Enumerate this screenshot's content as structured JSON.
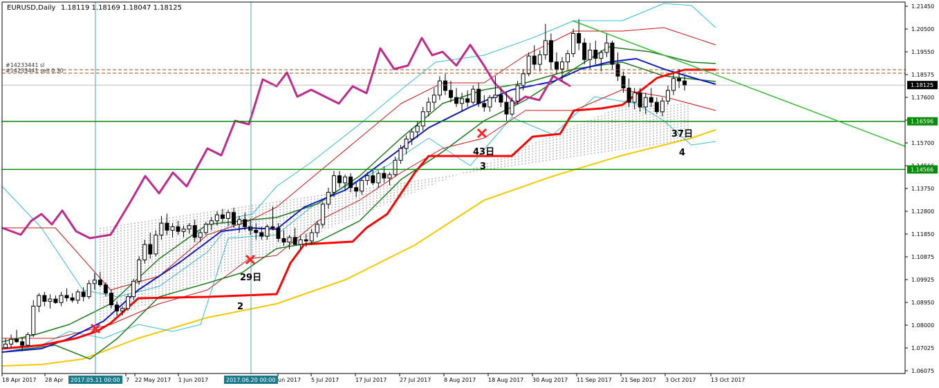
{
  "header": {
    "symbol": "EURUSD,Daily",
    "ohlc": "1.18119 1.18169 1.18047 1.18125"
  },
  "order_labels": [
    "#14233441 sl",
    "#14233441 sell 0.30"
  ],
  "colors": {
    "background": "#ffffff",
    "frame": "#000000",
    "bb_outer": "#33bbdd",
    "bb_inner": "#cc1111",
    "ma_green": "#1a7a1a",
    "ma_blue": "#0a14c8",
    "ma_gold": "#f5c800",
    "chikou": "#c0288c",
    "support_red": "#ff0000",
    "hline": "#0a8a0a",
    "trendline": "#33bb33",
    "current_badge": "#000000"
  },
  "price_axis": {
    "labels": [
      "1.21450",
      "1.20500",
      "1.19550",
      "1.18575",
      "1.17600",
      "1.16596",
      "1.15700",
      "1.14566",
      "1.13750",
      "1.12800",
      "1.11850",
      "1.10875",
      "1.09925",
      "1.08950",
      "1.08000",
      "1.07025",
      "1.06075"
    ],
    "current_price": "1.18125",
    "hline_labels": [
      "1.16596",
      "1.14566"
    ]
  },
  "time_axis": {
    "labels": [
      "18 Apr 2017",
      "28 Apr",
      "7",
      "22 May 2017",
      "1 Jun 2017",
      "un 2017",
      "5 Jul 2017",
      "17 Jul 2017",
      "27 Jul 2017",
      "8 Aug 2017",
      "18 Aug 2017",
      "30 Aug 2017",
      "11 Sep 2017",
      "21 Sep 2017",
      "3 Oct 2017",
      "13 Oct 2017"
    ],
    "crosshair_tags": [
      "2017.05.11 00:00",
      "2017.06.20 00:00"
    ]
  },
  "annotations": [
    {
      "text": "29日",
      "number": "2"
    },
    {
      "text": "43日",
      "number": "3"
    },
    {
      "text": "37日",
      "number": "4"
    }
  ],
  "chart_data": {
    "type": "candlestick",
    "symbol": "EURUSD",
    "timeframe": "Daily",
    "ylim": [
      1.06075,
      1.2145
    ],
    "last_close": 1.18125,
    "horizontal_levels": [
      1.16596,
      1.14566
    ],
    "candles_ohlc": [
      [
        1.0705,
        1.0745,
        1.07,
        1.072
      ],
      [
        1.072,
        1.076,
        1.0705,
        1.074
      ],
      [
        1.074,
        1.078,
        1.0725,
        1.073
      ],
      [
        1.073,
        1.0745,
        1.069,
        1.0715
      ],
      [
        1.0715,
        1.077,
        1.071,
        1.076
      ],
      [
        1.076,
        1.0905,
        1.075,
        1.088
      ],
      [
        1.088,
        1.0935,
        1.0855,
        1.0925
      ],
      [
        1.0925,
        1.094,
        1.088,
        1.09
      ],
      [
        1.09,
        1.093,
        1.087,
        1.091
      ],
      [
        1.091,
        1.0925,
        1.089,
        1.0895
      ],
      [
        1.0895,
        1.094,
        1.088,
        1.0925
      ],
      [
        1.0925,
        1.0955,
        1.09,
        1.0915
      ],
      [
        1.0915,
        1.0935,
        1.0895,
        1.0905
      ],
      [
        1.0905,
        1.095,
        1.089,
        1.094
      ],
      [
        1.094,
        1.096,
        1.09,
        1.092
      ],
      [
        1.092,
        1.099,
        1.091,
        1.0975
      ],
      [
        1.0975,
        1.102,
        1.095,
        1.099
      ],
      [
        1.099,
        1.1025,
        1.096,
        1.097
      ],
      [
        1.097,
        1.098,
        1.092,
        1.0935
      ],
      [
        1.0935,
        1.095,
        1.087,
        1.0885
      ],
      [
        1.0885,
        1.09,
        1.084,
        1.086
      ],
      [
        1.086,
        1.088,
        1.084,
        1.087
      ],
      [
        1.087,
        1.093,
        1.086,
        1.092
      ],
      [
        1.092,
        1.0995,
        1.0905,
        1.0985
      ],
      [
        1.0985,
        1.109,
        1.097,
        1.1075
      ],
      [
        1.1075,
        1.116,
        1.106,
        1.114
      ],
      [
        1.114,
        1.119,
        1.108,
        1.11
      ],
      [
        1.11,
        1.12,
        1.109,
        1.118
      ],
      [
        1.118,
        1.126,
        1.116,
        1.123
      ],
      [
        1.123,
        1.127,
        1.118,
        1.12
      ],
      [
        1.12,
        1.123,
        1.117,
        1.1215
      ],
      [
        1.1215,
        1.124,
        1.118,
        1.1195
      ],
      [
        1.1195,
        1.122,
        1.117,
        1.1205
      ],
      [
        1.1205,
        1.123,
        1.1185,
        1.122
      ],
      [
        1.122,
        1.1245,
        1.115,
        1.117
      ],
      [
        1.117,
        1.12,
        1.115,
        1.119
      ],
      [
        1.119,
        1.1235,
        1.118,
        1.1225
      ],
      [
        1.1225,
        1.1255,
        1.12,
        1.124
      ],
      [
        1.124,
        1.128,
        1.122,
        1.1265
      ],
      [
        1.1265,
        1.129,
        1.123,
        1.125
      ],
      [
        1.125,
        1.1285,
        1.122,
        1.1275
      ],
      [
        1.1275,
        1.1295,
        1.121,
        1.1225
      ],
      [
        1.1225,
        1.126,
        1.119,
        1.1245
      ],
      [
        1.1245,
        1.1275,
        1.12,
        1.1215
      ],
      [
        1.1215,
        1.125,
        1.118,
        1.12
      ],
      [
        1.12,
        1.123,
        1.116,
        1.119
      ],
      [
        1.119,
        1.1215,
        1.116,
        1.1175
      ],
      [
        1.1175,
        1.1225,
        1.116,
        1.1215
      ],
      [
        1.1215,
        1.13,
        1.12,
        1.121
      ],
      [
        1.121,
        1.123,
        1.115,
        1.1165
      ],
      [
        1.1165,
        1.12,
        1.1135,
        1.115
      ],
      [
        1.115,
        1.118,
        1.112,
        1.117
      ],
      [
        1.117,
        1.121,
        1.115,
        1.114
      ],
      [
        1.114,
        1.1175,
        1.112,
        1.116
      ],
      [
        1.116,
        1.1185,
        1.113,
        1.1155
      ],
      [
        1.1155,
        1.1205,
        1.114,
        1.119
      ],
      [
        1.119,
        1.124,
        1.117,
        1.1225
      ],
      [
        1.1225,
        1.132,
        1.121,
        1.131
      ],
      [
        1.131,
        1.138,
        1.129,
        1.136
      ],
      [
        1.136,
        1.145,
        1.134,
        1.143
      ],
      [
        1.143,
        1.145,
        1.138,
        1.14
      ],
      [
        1.14,
        1.1435,
        1.137,
        1.1425
      ],
      [
        1.1425,
        1.144,
        1.136,
        1.138
      ],
      [
        1.138,
        1.14,
        1.134,
        1.1365
      ],
      [
        1.1365,
        1.142,
        1.135,
        1.141
      ],
      [
        1.141,
        1.1445,
        1.139,
        1.143
      ],
      [
        1.143,
        1.146,
        1.139,
        1.14
      ],
      [
        1.14,
        1.145,
        1.138,
        1.144
      ],
      [
        1.144,
        1.147,
        1.14,
        1.142
      ],
      [
        1.142,
        1.1445,
        1.139,
        1.1435
      ],
      [
        1.1435,
        1.151,
        1.1425,
        1.1495
      ],
      [
        1.1495,
        1.156,
        1.148,
        1.1545
      ],
      [
        1.1545,
        1.16,
        1.152,
        1.1585
      ],
      [
        1.1585,
        1.163,
        1.156,
        1.1615
      ],
      [
        1.1615,
        1.166,
        1.159,
        1.164
      ],
      [
        1.164,
        1.172,
        1.162,
        1.17
      ],
      [
        1.17,
        1.176,
        1.168,
        1.174
      ],
      [
        1.174,
        1.18,
        1.171,
        1.177
      ],
      [
        1.177,
        1.185,
        1.175,
        1.183
      ],
      [
        1.183,
        1.186,
        1.177,
        1.179
      ],
      [
        1.179,
        1.183,
        1.174,
        1.176
      ],
      [
        1.176,
        1.18,
        1.172,
        1.1735
      ],
      [
        1.1735,
        1.178,
        1.17,
        1.1755
      ],
      [
        1.1755,
        1.179,
        1.172,
        1.174
      ],
      [
        1.174,
        1.181,
        1.173,
        1.1795
      ],
      [
        1.1795,
        1.182,
        1.172,
        1.1735
      ],
      [
        1.1735,
        1.177,
        1.17,
        1.172
      ],
      [
        1.172,
        1.177,
        1.17,
        1.176
      ],
      [
        1.176,
        1.185,
        1.174,
        1.177
      ],
      [
        1.177,
        1.18,
        1.172,
        1.174
      ],
      [
        1.174,
        1.178,
        1.166,
        1.169
      ],
      [
        1.169,
        1.176,
        1.168,
        1.1745
      ],
      [
        1.1745,
        1.183,
        1.173,
        1.181
      ],
      [
        1.181,
        1.188,
        1.179,
        1.186
      ],
      [
        1.186,
        1.195,
        1.185,
        1.1935
      ],
      [
        1.1935,
        1.198,
        1.188,
        1.19
      ],
      [
        1.19,
        1.196,
        1.187,
        1.194
      ],
      [
        1.194,
        1.207,
        1.192,
        1.2
      ],
      [
        1.2,
        1.203,
        1.188,
        1.191
      ],
      [
        1.191,
        1.195,
        1.186,
        1.188
      ],
      [
        1.188,
        1.193,
        1.183,
        1.191
      ],
      [
        1.191,
        1.196,
        1.188,
        1.1945
      ],
      [
        1.1945,
        1.205,
        1.193,
        1.203
      ],
      [
        1.203,
        1.209,
        1.196,
        1.199
      ],
      [
        1.199,
        1.201,
        1.19,
        1.192
      ],
      [
        1.192,
        1.199,
        1.188,
        1.196
      ],
      [
        1.196,
        1.2,
        1.19,
        1.1925
      ],
      [
        1.1925,
        1.196,
        1.187,
        1.195
      ],
      [
        1.195,
        1.203,
        1.193,
        1.199
      ],
      [
        1.199,
        1.2,
        1.188,
        1.19
      ],
      [
        1.19,
        1.195,
        1.183,
        1.185
      ],
      [
        1.185,
        1.187,
        1.178,
        1.18
      ],
      [
        1.18,
        1.184,
        1.172,
        1.174
      ],
      [
        1.174,
        1.18,
        1.171,
        1.178
      ],
      [
        1.178,
        1.18,
        1.17,
        1.172
      ],
      [
        1.172,
        1.178,
        1.169,
        1.176
      ],
      [
        1.176,
        1.18,
        1.172,
        1.174
      ],
      [
        1.174,
        1.176,
        1.169,
        1.17
      ],
      [
        1.17,
        1.176,
        1.168,
        1.1745
      ],
      [
        1.1745,
        1.181,
        1.173,
        1.179
      ],
      [
        1.179,
        1.186,
        1.177,
        1.184
      ],
      [
        1.184,
        1.188,
        1.18,
        1.183
      ],
      [
        1.183,
        1.185,
        1.179,
        1.1812
      ]
    ],
    "markers": [
      {
        "label": "2",
        "ann": "",
        "x_index": 19,
        "y": 1.0795
      },
      {
        "label": "29日",
        "x_index": 52,
        "y": 1.108
      },
      {
        "label": "43日",
        "x_index": 90,
        "y": 1.161
      },
      {
        "label": "37日",
        "x_index": 120,
        "y": 1.161
      }
    ]
  }
}
